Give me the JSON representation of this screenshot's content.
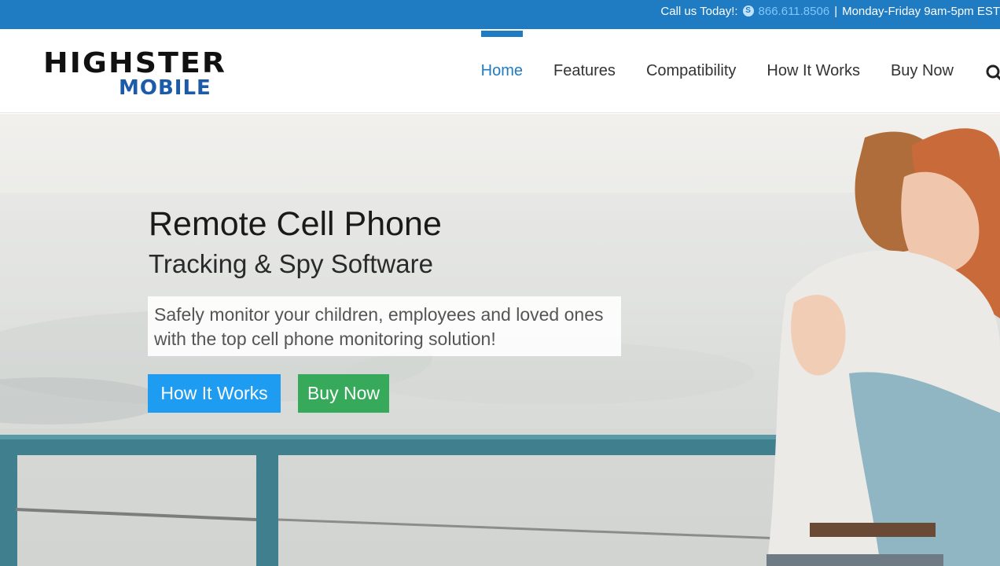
{
  "topbar": {
    "call_label": "Call us Today!:",
    "phone": "866.611.8506",
    "separator": "|",
    "hours": "Monday-Friday 9am-5pm EST",
    "skype_icon": "skype-icon"
  },
  "logo": {
    "top": "HIGHSTER",
    "bottom": "MOBILE"
  },
  "nav": {
    "items": [
      {
        "label": "Home",
        "active": true
      },
      {
        "label": "Features"
      },
      {
        "label": "Compatibility"
      },
      {
        "label": "How It Works"
      },
      {
        "label": "Buy Now"
      }
    ],
    "search_icon": "search-icon"
  },
  "hero": {
    "title": "Remote Cell Phone",
    "subtitle": "Tracking & Spy Software",
    "description": "Safely monitor your children, employees and loved ones with the top cell phone monitoring solution!",
    "buttons": {
      "how_it_works": "How It Works",
      "buy_now": "Buy Now"
    }
  },
  "colors": {
    "topbar": "#1f7bc2",
    "nav_active": "#1f7bc2",
    "btn_how": "#1e9cf2",
    "btn_buy": "#36a95b",
    "logo_blue": "#1c5ba8"
  }
}
